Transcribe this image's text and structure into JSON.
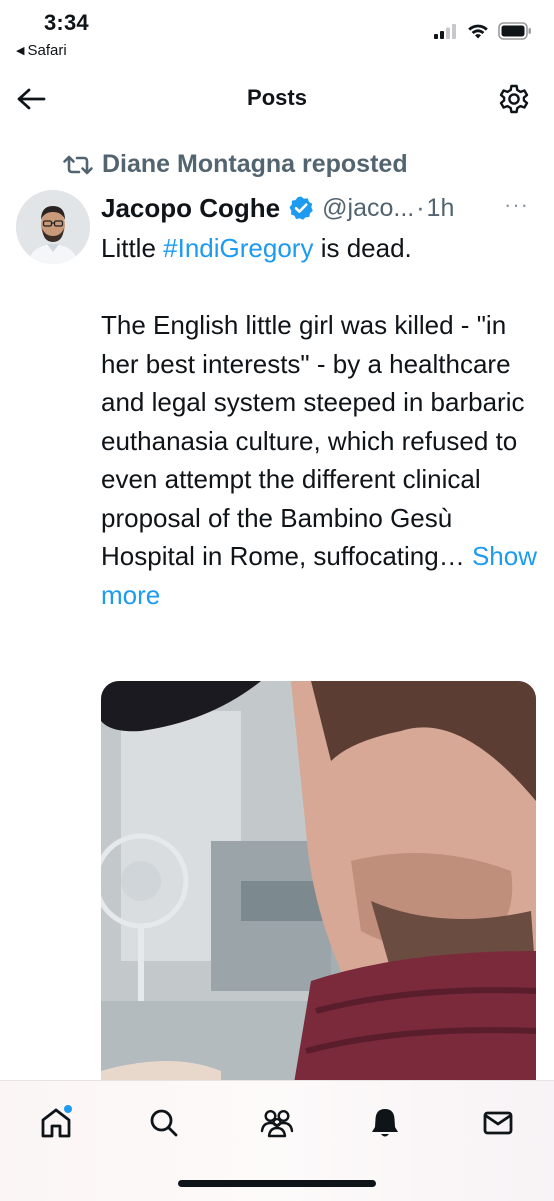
{
  "status_bar": {
    "time": "3:34",
    "back_app": "Safari"
  },
  "header": {
    "title": "Posts"
  },
  "repost": {
    "text": "Diane Montagna reposted"
  },
  "post": {
    "author_name": "Jacopo Coghe",
    "handle": "@jaco...",
    "separator": "·",
    "time": "1h",
    "more": "···",
    "line1_prefix": "Little ",
    "hashtag": "#IndiGregory",
    "line1_suffix": " is dead.",
    "body": " The English little girl was killed - \"in her best interests\" - by a healthcare and legal system steeped in barbaric euthanasia culture, which refused to even attempt the different clinical proposal of the Bambino Gesù Hospital in Rome, suffocating…",
    "show_more": "Show more"
  },
  "tab_bar": {
    "items": [
      "home-icon",
      "search-icon",
      "communities-icon",
      "notifications-icon",
      "messages-icon"
    ]
  },
  "colors": {
    "accent": "#1d9bf0",
    "secondary_text": "#536471",
    "primary_text": "#0f1419"
  }
}
